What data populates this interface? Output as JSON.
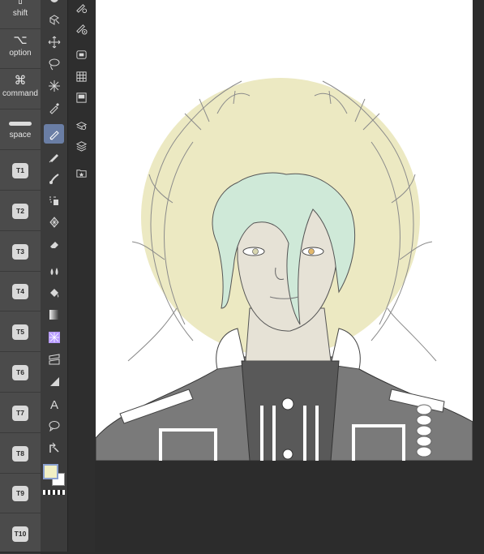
{
  "modifier_keys": [
    {
      "symbol": "⇧",
      "label": "shift"
    },
    {
      "symbol": "⌥",
      "label": "option"
    },
    {
      "symbol": "⌘",
      "label": "command"
    },
    {
      "symbol": "",
      "label": "space"
    }
  ],
  "shortcut_keys": [
    "T1",
    "T2",
    "T3",
    "T4",
    "T5",
    "T6",
    "T7",
    "T8",
    "T9",
    "T10"
  ],
  "tools": [
    {
      "icon": "select-layer-icon",
      "active": false
    },
    {
      "icon": "move-icon",
      "active": false
    },
    {
      "icon": "lasso-icon",
      "active": false
    },
    {
      "icon": "magic-wand-icon",
      "active": false
    },
    {
      "icon": "eyedropper-icon",
      "active": false
    },
    {
      "icon": "pen-icon",
      "active": true
    },
    {
      "icon": "pencil-icon",
      "active": false
    },
    {
      "icon": "brush-icon",
      "active": false
    },
    {
      "icon": "airbrush-icon",
      "active": false
    },
    {
      "icon": "decoration-icon",
      "active": false
    },
    {
      "icon": "eraser-icon",
      "active": false
    },
    {
      "icon": "blend-icon",
      "active": false
    },
    {
      "icon": "fill-icon",
      "active": false
    },
    {
      "icon": "gradient-icon",
      "active": false
    },
    {
      "icon": "figure-icon",
      "active": false
    },
    {
      "icon": "frame-icon",
      "active": false
    },
    {
      "icon": "ruler-icon",
      "active": false
    },
    {
      "icon": "text-icon",
      "active": false
    },
    {
      "icon": "balloon-icon",
      "active": false
    },
    {
      "icon": "correct-line-icon",
      "active": false
    }
  ],
  "colors": {
    "main": "#f1efc4",
    "sub": "#ffffff",
    "active_tool": "#6a7ea5",
    "halo": "#ece9c2",
    "hair": "#cfe9d8",
    "skin": "#e6e2d6",
    "uniform": "#7a7a7a",
    "inner": "#595959"
  },
  "commands": [
    {
      "icon": "tool-settings-icon"
    },
    {
      "icon": "brush-size-icon"
    },
    {
      "icon": "navigator-icon"
    },
    {
      "icon": "layer-property-icon"
    },
    {
      "icon": "sub-view-icon"
    },
    {
      "icon": "layer-search-icon"
    },
    {
      "icon": "layers-icon"
    },
    {
      "icon": "material-icon"
    }
  ]
}
